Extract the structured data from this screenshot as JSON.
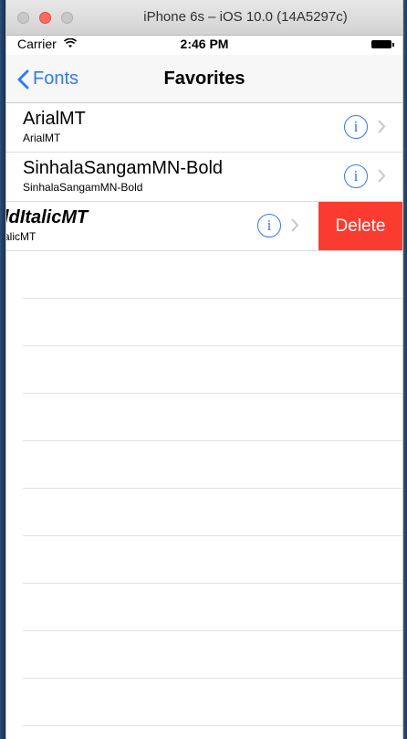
{
  "window": {
    "title": "iPhone 6s – iOS 10.0 (14A5297c)"
  },
  "status": {
    "carrier": "Carrier",
    "wifi_icon": "wifi-icon",
    "time": "2:46 PM"
  },
  "nav": {
    "back_label": "Fonts",
    "title": "Favorites"
  },
  "rows": [
    {
      "name": "ArialMT",
      "subtitle": "ArialMT"
    },
    {
      "name": "SinhalaSangamMN-Bold",
      "subtitle": "SinhalaSangamMN-Bold"
    },
    {
      "name": "ldItalicMT",
      "subtitle": "alicMT",
      "swiped": true,
      "delete_label": "Delete"
    }
  ],
  "colors": {
    "tint": "#3478f6",
    "delete": "#fb3b30"
  }
}
